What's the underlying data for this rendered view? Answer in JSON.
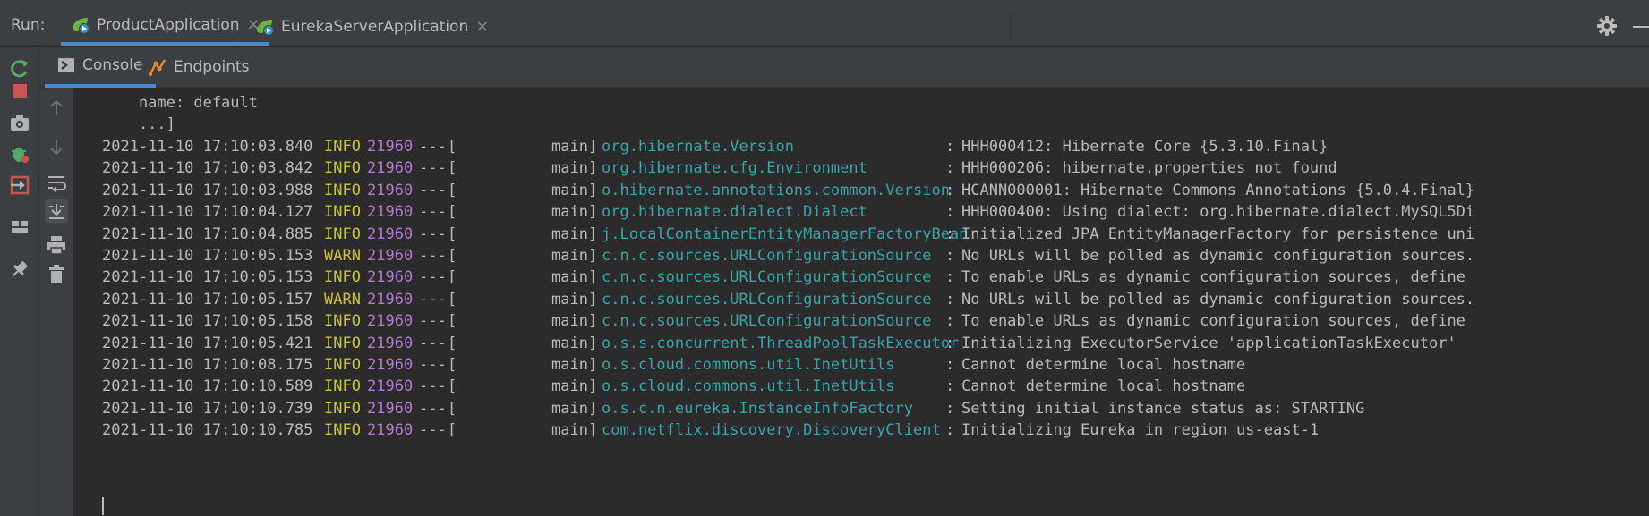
{
  "run_panel": {
    "label": "Run:",
    "tabs": [
      {
        "label": "ProductApplication",
        "active": true
      },
      {
        "label": "EurekaServerApplication",
        "active": false
      }
    ],
    "close_glyph": "×"
  },
  "sub_tabs": [
    {
      "label": "Console",
      "icon": "console-icon",
      "active": true
    },
    {
      "label": "Endpoints",
      "icon": "endpoints-icon",
      "active": false
    }
  ],
  "left_toolbar": [
    "rerun-icon",
    "stop-icon",
    "camera-icon",
    "debug-icon",
    "exit-icon",
    "layout-icon",
    "pin-icon"
  ],
  "console_toolbar": [
    "up-arrow-icon",
    "down-arrow-icon",
    "soft-wrap-icon",
    "scroll-to-end-icon",
    "print-icon",
    "trash-icon"
  ],
  "console": {
    "header_lines": [
      "    name: default",
      "    ...]"
    ],
    "rows": [
      {
        "ts": "2021-11-10 17:10:03.840",
        "level": "INFO",
        "pid": "21960",
        "thread": "main",
        "logger": "org.hibernate.Version",
        "msg": "HHH000412: Hibernate Core {5.3.10.Final}"
      },
      {
        "ts": "2021-11-10 17:10:03.842",
        "level": "INFO",
        "pid": "21960",
        "thread": "main",
        "logger": "org.hibernate.cfg.Environment",
        "msg": "HHH000206: hibernate.properties not found"
      },
      {
        "ts": "2021-11-10 17:10:03.988",
        "level": "INFO",
        "pid": "21960",
        "thread": "main",
        "logger": "o.hibernate.annotations.common.Version",
        "msg": "HCANN000001: Hibernate Commons Annotations {5.0.4.Final}"
      },
      {
        "ts": "2021-11-10 17:10:04.127",
        "level": "INFO",
        "pid": "21960",
        "thread": "main",
        "logger": "org.hibernate.dialect.Dialect",
        "msg": "HHH000400: Using dialect: org.hibernate.dialect.MySQL5Di"
      },
      {
        "ts": "2021-11-10 17:10:04.885",
        "level": "INFO",
        "pid": "21960",
        "thread": "main",
        "logger": "j.LocalContainerEntityManagerFactoryBean",
        "msg": "Initialized JPA EntityManagerFactory for persistence uni"
      },
      {
        "ts": "2021-11-10 17:10:05.153",
        "level": "WARN",
        "pid": "21960",
        "thread": "main",
        "logger": "c.n.c.sources.URLConfigurationSource",
        "msg": "No URLs will be polled as dynamic configuration sources."
      },
      {
        "ts": "2021-11-10 17:10:05.153",
        "level": "INFO",
        "pid": "21960",
        "thread": "main",
        "logger": "c.n.c.sources.URLConfigurationSource",
        "msg": "To enable URLs as dynamic configuration sources, define"
      },
      {
        "ts": "2021-11-10 17:10:05.157",
        "level": "WARN",
        "pid": "21960",
        "thread": "main",
        "logger": "c.n.c.sources.URLConfigurationSource",
        "msg": "No URLs will be polled as dynamic configuration sources."
      },
      {
        "ts": "2021-11-10 17:10:05.158",
        "level": "INFO",
        "pid": "21960",
        "thread": "main",
        "logger": "c.n.c.sources.URLConfigurationSource",
        "msg": "To enable URLs as dynamic configuration sources, define"
      },
      {
        "ts": "2021-11-10 17:10:05.421",
        "level": "INFO",
        "pid": "21960",
        "thread": "main",
        "logger": "o.s.s.concurrent.ThreadPoolTaskExecutor",
        "msg": "Initializing ExecutorService 'applicationTaskExecutor'"
      },
      {
        "ts": "2021-11-10 17:10:08.175",
        "level": "INFO",
        "pid": "21960",
        "thread": "main",
        "logger": "o.s.cloud.commons.util.InetUtils",
        "msg": "Cannot determine local hostname"
      },
      {
        "ts": "2021-11-10 17:10:10.589",
        "level": "INFO",
        "pid": "21960",
        "thread": "main",
        "logger": "o.s.cloud.commons.util.InetUtils",
        "msg": "Cannot determine local hostname"
      },
      {
        "ts": "2021-11-10 17:10:10.739",
        "level": "INFO",
        "pid": "21960",
        "thread": "main",
        "logger": "o.s.c.n.eureka.InstanceInfoFactory",
        "msg": "Setting initial instance status as: STARTING"
      },
      {
        "ts": "2021-11-10 17:10:10.785",
        "level": "INFO",
        "pid": "21960",
        "thread": "main",
        "logger": "com.netflix.discovery.DiscoveryClient",
        "msg": "Initializing Eureka in region us-east-1"
      }
    ],
    "separator": "---",
    "bracket_open": "[",
    "colon": ":"
  },
  "colors": {
    "background": "#2b2b2b",
    "panel": "#3c3f41",
    "accent": "#4a88c7",
    "info": "#c6c63f",
    "pid": "#b57ad1",
    "logger": "#3aa5a5"
  }
}
